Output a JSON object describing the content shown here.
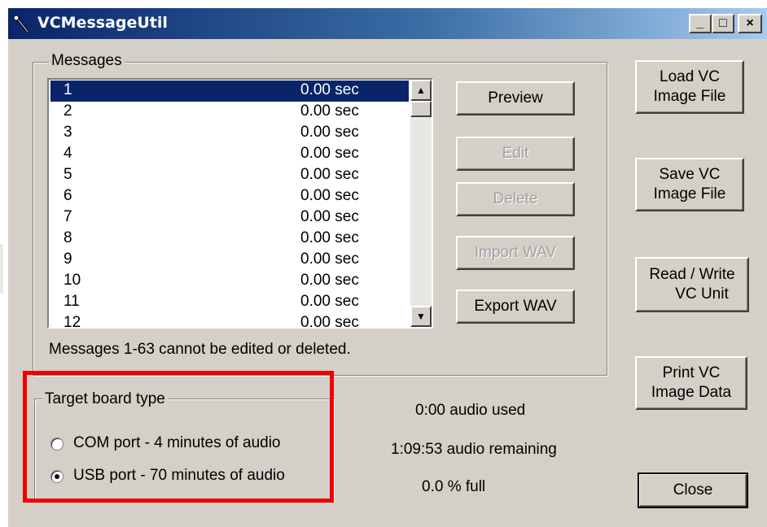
{
  "window": {
    "title": "VCMessageUtil",
    "minimize": "_",
    "maximize": "□",
    "close": "×"
  },
  "messages_group": {
    "label": "Messages",
    "rows": [
      {
        "num": "1",
        "dur": "0.00 sec",
        "selected": true
      },
      {
        "num": "2",
        "dur": "0.00 sec"
      },
      {
        "num": "3",
        "dur": "0.00 sec"
      },
      {
        "num": "4",
        "dur": "0.00 sec"
      },
      {
        "num": "5",
        "dur": "0.00 sec"
      },
      {
        "num": "6",
        "dur": "0.00 sec"
      },
      {
        "num": "7",
        "dur": "0.00 sec"
      },
      {
        "num": "8",
        "dur": "0.00 sec"
      },
      {
        "num": "9",
        "dur": "0.00 sec"
      },
      {
        "num": "10",
        "dur": "0.00 sec"
      },
      {
        "num": "11",
        "dur": "0.00 sec"
      },
      {
        "num": "12",
        "dur": "0.00 sec"
      }
    ],
    "note": "Messages 1-63 cannot be edited or deleted.",
    "preview": "Preview",
    "edit": "Edit",
    "delete": "Delete",
    "import_wav": "Import WAV",
    "export_wav": "Export WAV"
  },
  "side_buttons": {
    "load": [
      "Load VC",
      "Image File"
    ],
    "save": [
      "Save VC",
      "Image File"
    ],
    "readwrite": [
      "Read / Write",
      "VC Unit"
    ],
    "print": [
      "Print VC",
      "Image Data"
    ],
    "close": "Close"
  },
  "target_group": {
    "label": "Target board type",
    "com": "COM port - 4 minutes of audio",
    "usb": "USB port - 70 minutes of audio",
    "selected": "usb"
  },
  "status": {
    "used": "0:00 audio used",
    "remaining": "1:09:53 audio remaining",
    "full": "0.0 % full"
  },
  "colors": {
    "selection": "#0a246a",
    "highlight_box": "#ee0000",
    "face": "#d4d0c8"
  },
  "icons": {
    "scroll_up": "▲",
    "scroll_down": "▼"
  }
}
